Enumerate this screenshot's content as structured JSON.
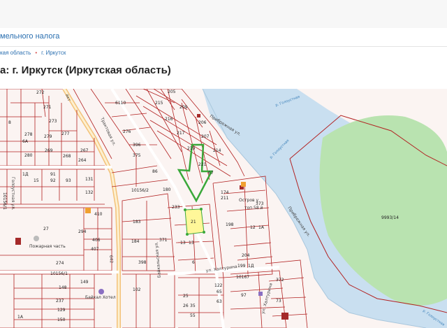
{
  "header": {
    "link_text": "мельного налога"
  },
  "breadcrumb": {
    "item1": "кая область",
    "item2": "г. Иркутск"
  },
  "page_title": "а: г. Иркутск (Иркутская область)",
  "map": {
    "colors": {
      "river": "#c9dff0",
      "park": "#b9e3b0",
      "parcel_line": "#b22222",
      "highlight": "#fff799",
      "arrow": "#3aa83a",
      "road": "#f3c27a"
    },
    "streets": {
      "pribrezhnaya1": "Прибрежная ул.",
      "pribrezhnaya2": "Прибрежная ул.",
      "traktovaya": "Трактовая ул.",
      "baykalskaya": "Байкальская ул.",
      "golousnaya": "Голоустная ул.",
      "khaltugina": "ул. Халтурина",
      "trakt_top": "акт"
    },
    "rivers": {
      "top": "р. Голоустная",
      "mid": "р. Голоустная",
      "bottom": "р. Голоустная"
    },
    "pois": {
      "fire": "Пожарная часть",
      "island1": "Остров у",
      "island2": "топ 58 й",
      "hotel": "Байкал Хотел"
    },
    "parcels": {
      "p272": "272",
      "p271": "271",
      "p273": "273",
      "p8": "8",
      "p278": "278",
      "p279": "279",
      "p277": "277",
      "p6A": "6А",
      "p280": "280",
      "p269": "269",
      "p268": "268",
      "p267": "267",
      "p264": "264",
      "p1D_a": "1Д",
      "p15": "15",
      "p92": "92",
      "p91": "91",
      "p93": "93",
      "p131": "131",
      "p132": "132",
      "p6110": "6110",
      "p276": "276",
      "p396": "396",
      "p375": "375",
      "p86": "86",
      "p180": "180",
      "p10156_2": "10156/2",
      "p205": "205",
      "p215": "215",
      "p209": "209",
      "p216": "216",
      "p206": "206",
      "p217": "217",
      "p207": "207",
      "p219": "219",
      "p214": "214",
      "p221": "221",
      "p67": "67",
      "p174": "174",
      "p211": "211",
      "p373": "373",
      "p198": "198",
      "p12": "12",
      "p1A": "1А",
      "p204": "204",
      "p199": "199",
      "p1D_b": "1Д",
      "p233": "233",
      "p183": "183",
      "p371": "371",
      "p13a": "13",
      "p13b": "13",
      "p184": "184",
      "p398": "398",
      "p6": "6",
      "p21": "21",
      "p410": "410",
      "p294": "294",
      "p406": "406",
      "p407": "407",
      "p27": "27",
      "p274": "274",
      "p10156_1": "10156/1",
      "p642": "642",
      "p148": "148",
      "p149": "149",
      "p237": "237",
      "p129": "129",
      "p150": "150",
      "p1Ab": "1А",
      "p102": "102",
      "p10167": "10167",
      "p97": "97",
      "p65": "65",
      "p63": "63",
      "p122": "122",
      "p25": "25",
      "p26": "26",
      "p35": "35",
      "p55": "55",
      "p73": "73",
      "p372": "372",
      "p9993_14": "9993/14",
      "p10156_a": "10156/1"
    }
  }
}
